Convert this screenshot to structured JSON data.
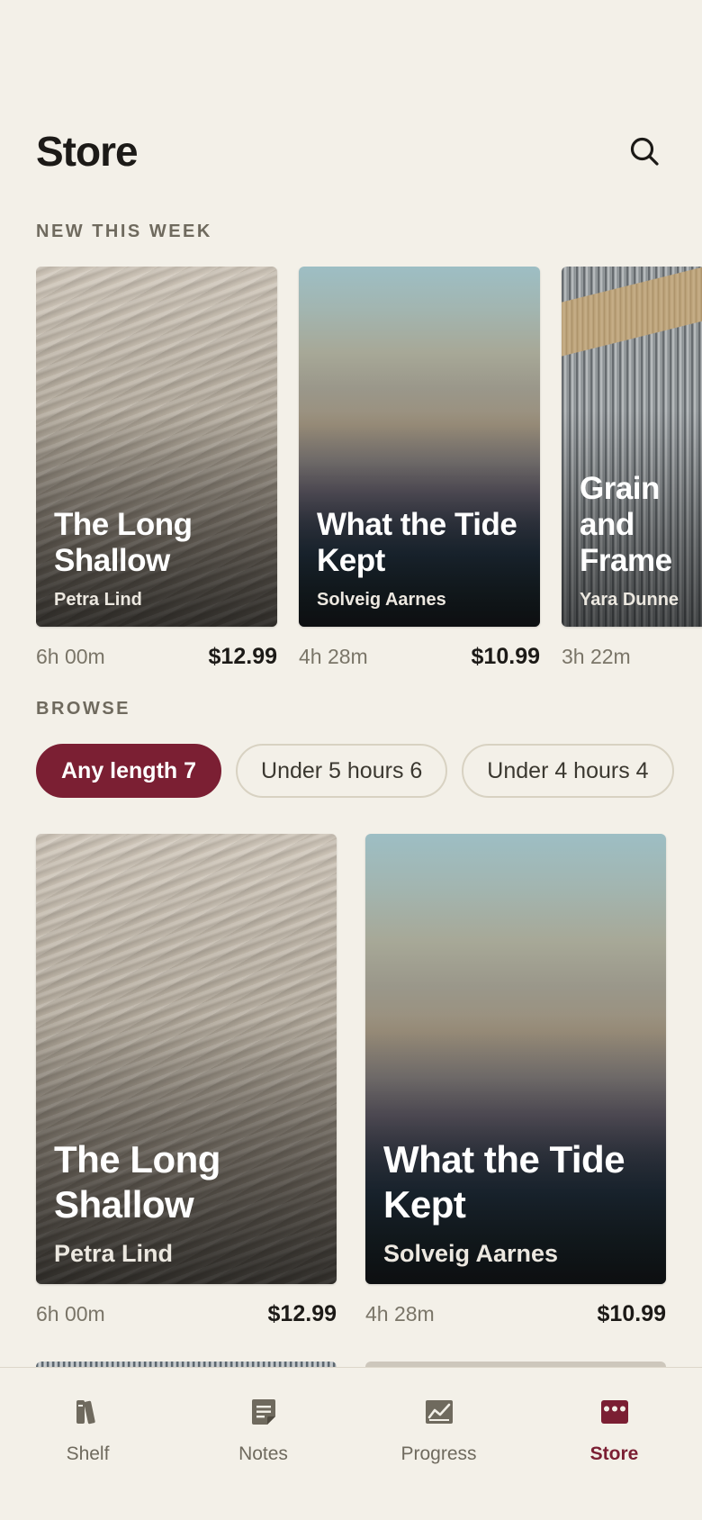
{
  "header": {
    "title": "Store",
    "search_icon": "search-icon"
  },
  "new_this_week": {
    "label": "NEW THIS WEEK",
    "items": [
      {
        "title": "The Long Shallow",
        "author": "Petra Lind",
        "duration": "6h 00m",
        "price": "$12.99",
        "cover": "sand"
      },
      {
        "title": "What the Tide Kept",
        "author": "Solveig Aarnes",
        "duration": "4h 28m",
        "price": "$10.99",
        "cover": "sea"
      },
      {
        "title": "Grain and Frame",
        "author": "Yara Dunne",
        "duration": "3h 22m",
        "price": "",
        "cover": "grain"
      }
    ]
  },
  "browse": {
    "label": "BROWSE",
    "filters": [
      {
        "label": "Any length 7",
        "active": true
      },
      {
        "label": "Under 5 hours 6",
        "active": false
      },
      {
        "label": "Under 4 hours 4",
        "active": false
      }
    ],
    "items": [
      {
        "title": "The Long Shallow",
        "author": "Petra Lind",
        "duration": "6h 00m",
        "price": "$12.99",
        "cover": "sand"
      },
      {
        "title": "What the Tide Kept",
        "author": "Solveig Aarnes",
        "duration": "4h 28m",
        "price": "$10.99",
        "cover": "sea"
      }
    ]
  },
  "tabs": [
    {
      "label": "Shelf",
      "icon": "books-icon",
      "active": false
    },
    {
      "label": "Notes",
      "icon": "note-icon",
      "active": false
    },
    {
      "label": "Progress",
      "icon": "chart-icon",
      "active": false
    },
    {
      "label": "Store",
      "icon": "store-icon",
      "active": true
    }
  ],
  "colors": {
    "accent": "#7b1f33",
    "background": "#f3f0e8",
    "muted": "#6f6a5e"
  }
}
